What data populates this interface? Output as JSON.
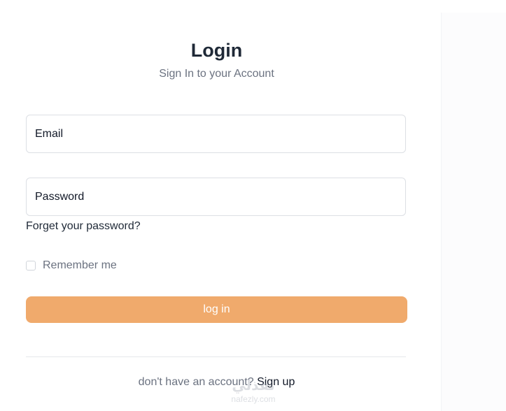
{
  "form": {
    "title": "Login",
    "subtitle": "Sign In to your Account",
    "email_placeholder": "Email",
    "password_placeholder": "Password",
    "forgot_password": "Forget your password?",
    "remember_me": "Remember me",
    "remember_checked": false,
    "submit_label": "log in",
    "signup_prompt": "don't have an account?",
    "signup_link": "Sign up"
  },
  "watermark": {
    "domain": "nafezly.com"
  },
  "colors": {
    "button": "#f0aa6c",
    "title": "#1f2937",
    "muted": "#6b7280",
    "border": "#dcdfe4"
  }
}
